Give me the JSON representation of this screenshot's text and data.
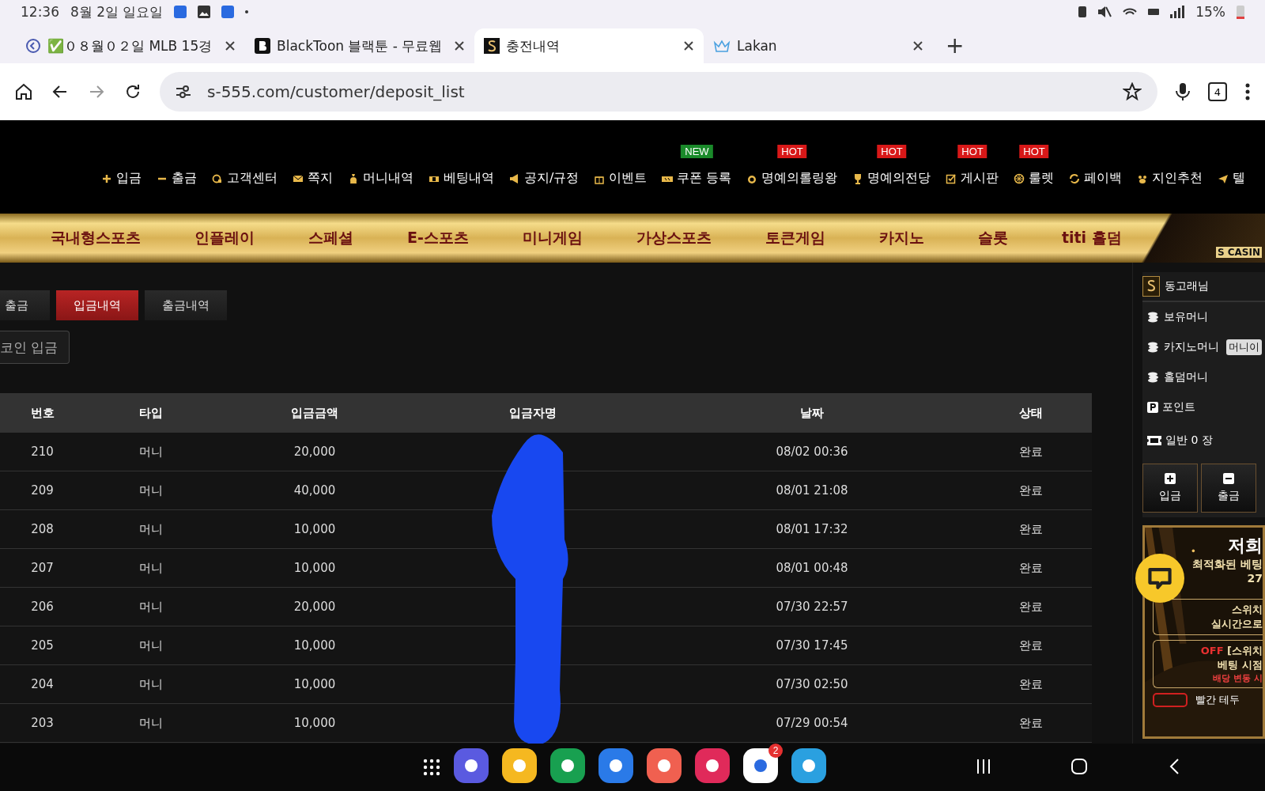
{
  "status_bar": {
    "time": "12:36",
    "date": "8월 2일 일요일",
    "battery": "15%"
  },
  "browser": {
    "tabs": [
      {
        "title": "✅０８월０２일 MLB 15경",
        "selected": false
      },
      {
        "title": "BlackToon 블랙툰 - 무료웹",
        "selected": false
      },
      {
        "title": "충전내역",
        "selected": true
      },
      {
        "title": "Lakan",
        "selected": false
      }
    ],
    "new_tab": "+",
    "url": "s-555.com/customer/deposit_list",
    "tab_count": "4"
  },
  "top_menu": [
    {
      "label": "입금"
    },
    {
      "label": "출금"
    },
    {
      "label": "고객센터"
    },
    {
      "label": "쪽지"
    },
    {
      "label": "머니내역"
    },
    {
      "label": "베팅내역"
    },
    {
      "label": "공지/규정"
    },
    {
      "label": "이벤트"
    },
    {
      "label": "쿠폰 등록",
      "badge": {
        "text": "NEW",
        "kind": "new"
      }
    },
    {
      "label": "명예의롤링왕",
      "badge": {
        "text": "HOT",
        "kind": "hot"
      }
    },
    {
      "label": "명예의전당",
      "badge": {
        "text": "HOT",
        "kind": "hot"
      }
    },
    {
      "label": "게시판",
      "badge": {
        "text": "HOT",
        "kind": "hot"
      }
    },
    {
      "label": "룰렛",
      "badge": {
        "text": "HOT",
        "kind": "hot"
      }
    },
    {
      "label": "페이백"
    },
    {
      "label": "지인추천"
    },
    {
      "label": "텔"
    }
  ],
  "game_menu": [
    "국내형스포츠",
    "인플레이",
    "스페셜",
    "E-스포츠",
    "미니게임",
    "가상스포츠",
    "토큰게임",
    "카지노",
    "슬롯",
    "titi 홀덤"
  ],
  "game_menu_logo": "S CASIN",
  "sub_tabs": [
    {
      "label": "출금",
      "selected": false
    },
    {
      "label": "입금내역",
      "selected": true
    },
    {
      "label": "출금내역",
      "selected": false
    }
  ],
  "coin_button": "코인 입금",
  "table": {
    "columns": [
      "번호",
      "타입",
      "입금금액",
      "입금자명",
      "날짜",
      "상태"
    ],
    "redacted": true,
    "rows": [
      {
        "number": "210",
        "type": "머니",
        "amount": "20,000",
        "date": "08/02 00:36",
        "status": "완료"
      },
      {
        "number": "209",
        "type": "머니",
        "amount": "40,000",
        "date": "08/01 21:08",
        "status": "완료"
      },
      {
        "number": "208",
        "type": "머니",
        "amount": "10,000",
        "date": "08/01 17:32",
        "status": "완료"
      },
      {
        "number": "207",
        "type": "머니",
        "amount": "10,000",
        "date": "08/01 00:48",
        "status": "완료"
      },
      {
        "number": "206",
        "type": "머니",
        "amount": "20,000",
        "date": "07/30 22:57",
        "status": "완료"
      },
      {
        "number": "205",
        "type": "머니",
        "amount": "10,000",
        "date": "07/30 17:45",
        "status": "완료"
      },
      {
        "number": "204",
        "type": "머니",
        "amount": "10,000",
        "date": "07/30 02:50",
        "status": "완료"
      },
      {
        "number": "203",
        "type": "머니",
        "amount": "10,000",
        "date": "07/29 00:54",
        "status": "완료"
      }
    ]
  },
  "sidebar": {
    "username": "동고래님",
    "items": [
      {
        "kind": "coins",
        "label": "보유머니"
      },
      {
        "kind": "coins",
        "label": "카지노머니",
        "button": "머니이"
      },
      {
        "kind": "coins",
        "label": "홀덤머니"
      },
      {
        "kind": "point",
        "label": "포인트"
      },
      {
        "kind": "ticket",
        "label": "일반 0 장"
      }
    ],
    "buttons": [
      {
        "kind": "plus",
        "label": "입금"
      },
      {
        "kind": "minus",
        "label": "출금"
      }
    ],
    "banner": {
      "title": "저희",
      "lines": [
        "최적화된 베팅",
        "27"
      ],
      "box1": [
        "스위치",
        "실시간으로"
      ],
      "off": "OFF",
      "box2_title": "[스위치",
      "box2_lines": [
        "베팅 시점"
      ],
      "box2_warn": "배당 변동 시",
      "footer": "빨간 테두"
    }
  },
  "dock": {
    "badge": "2"
  }
}
